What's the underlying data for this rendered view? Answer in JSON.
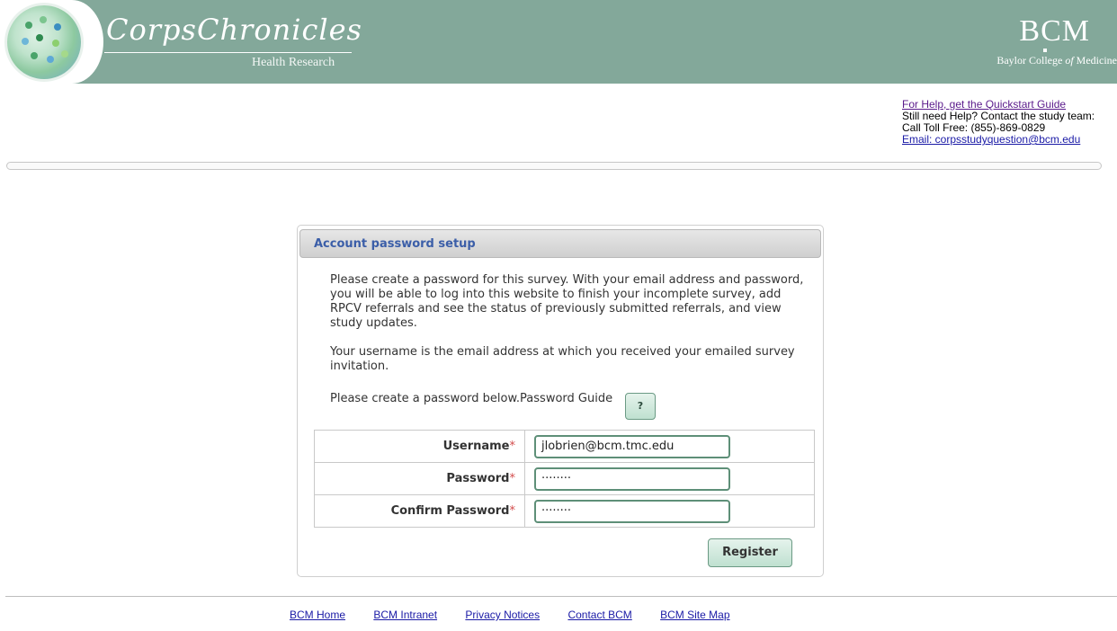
{
  "header": {
    "brand_title": "CorpsChronicles",
    "brand_subtitle": "Health Research",
    "org_logo": "BCM",
    "org_name_prefix": "Baylor College",
    "org_name_of": "of",
    "org_name_suffix": "Medicine"
  },
  "help": {
    "quickstart_link": "For Help, get the Quickstart Guide",
    "still_need": "Still need Help? Contact the study team:",
    "toll_free": "Call Toll Free: (855)-869-0829",
    "email_link": "Email: corpsstudyquestion@bcm.edu"
  },
  "panel": {
    "title": "Account password setup",
    "paragraph1": "Please create a password for this survey. With your email address and password, you will be able to log into this website to finish your incomplete survey, add RPCV referrals and see the status of previously submitted referrals, and view study updates.",
    "paragraph2": "Your username is the email address at which you received your emailed survey invitation.",
    "guide_text": "Please create a password below.Password Guide",
    "guide_button": "?",
    "fields": {
      "username_label": "Username",
      "username_value": "jlobrien@bcm.tmc.edu",
      "password_label": "Password",
      "password_value": "········",
      "confirm_label": "Confirm Password",
      "confirm_value": "········",
      "required_mark": "*"
    },
    "register_button": "Register"
  },
  "footer": {
    "links": [
      "BCM Home",
      "BCM Intranet",
      "Privacy Notices",
      "Contact BCM",
      "BCM Site Map"
    ]
  },
  "colors": {
    "banner": "#83a89a",
    "panel_title": "#3b5ea8",
    "button_border": "#6b9a84",
    "required": "#d24b4b",
    "link": "#1a1aa6",
    "visited_link": "#5a1a8b"
  }
}
